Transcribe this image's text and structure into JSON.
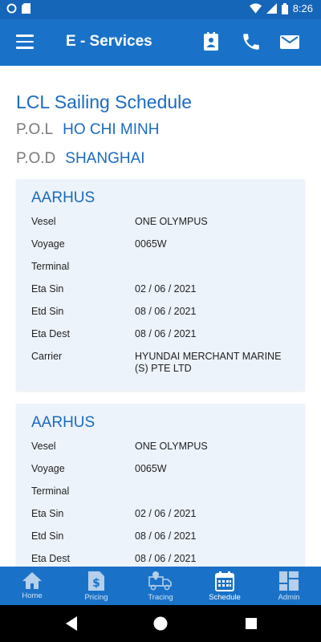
{
  "status_bar": {
    "time": "8:26"
  },
  "app_bar": {
    "title": "E - Services"
  },
  "page": {
    "title": "LCL Sailing Schedule",
    "pol_label": "P.O.L",
    "pol_value": "HO CHI MINH",
    "pod_label": "P.O.D",
    "pod_value": "SHANGHAI"
  },
  "cards": [
    {
      "name": "AARHUS",
      "rows": [
        {
          "label": "Vesel",
          "value": "ONE OLYMPUS"
        },
        {
          "label": "Voyage",
          "value": "0065W"
        },
        {
          "label": "Terminal",
          "value": ""
        },
        {
          "label": "Eta Sin",
          "value": "02 / 06 / 2021"
        },
        {
          "label": "Etd Sin",
          "value": "08 / 06 / 2021"
        },
        {
          "label": "Eta Dest",
          "value": "08 / 06 / 2021"
        },
        {
          "label": "Carrier",
          "value": "HYUNDAI MERCHANT MARINE (S) PTE LTD"
        }
      ]
    },
    {
      "name": "AARHUS",
      "rows": [
        {
          "label": "Vesel",
          "value": "ONE OLYMPUS"
        },
        {
          "label": "Voyage",
          "value": "0065W"
        },
        {
          "label": "Terminal",
          "value": ""
        },
        {
          "label": "Eta Sin",
          "value": "02 / 06 / 2021"
        },
        {
          "label": "Etd Sin",
          "value": "08 / 06 / 2021"
        },
        {
          "label": "Eta Dest",
          "value": "08 / 06 / 2021"
        }
      ]
    }
  ],
  "bottom_nav": [
    {
      "label": "Home",
      "icon": "home-icon"
    },
    {
      "label": "Pricing",
      "icon": "pricing-icon"
    },
    {
      "label": "Tracing",
      "icon": "tracing-icon"
    },
    {
      "label": "Schedule",
      "icon": "calendar-icon",
      "active": true
    },
    {
      "label": "Admin",
      "icon": "dashboard-icon"
    }
  ],
  "colors": {
    "primary": "#1a72c8",
    "accent_text": "#1a6bbf",
    "card_bg": "#edf3fb"
  }
}
